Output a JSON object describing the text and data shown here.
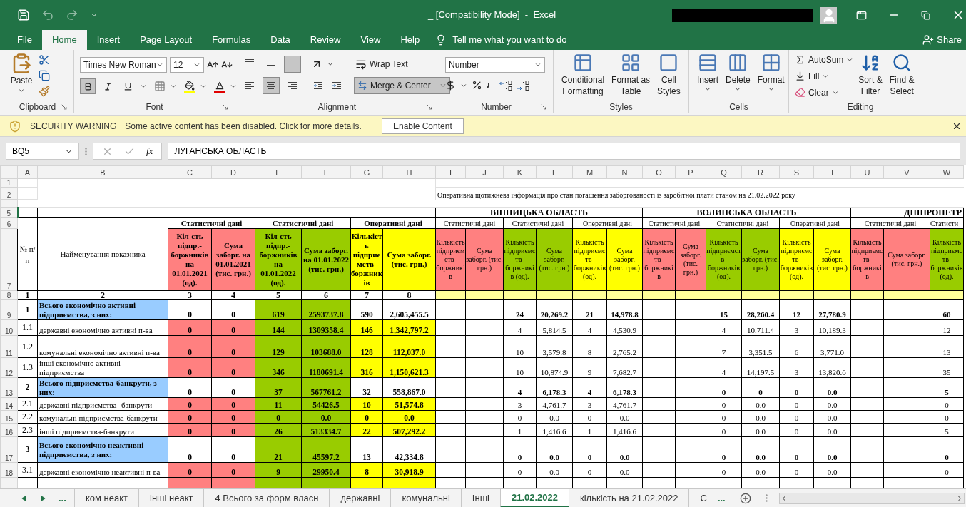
{
  "title_bar": {
    "title": "_ [Compatibility Mode]  -  Excel"
  },
  "ribbon_tabs": [
    {
      "label": "File",
      "selected": false
    },
    {
      "label": "Home",
      "selected": true
    },
    {
      "label": "Insert",
      "selected": false
    },
    {
      "label": "Page Layout",
      "selected": false
    },
    {
      "label": "Formulas",
      "selected": false
    },
    {
      "label": "Data",
      "selected": false
    },
    {
      "label": "Review",
      "selected": false
    },
    {
      "label": "View",
      "selected": false
    },
    {
      "label": "Help",
      "selected": false
    }
  ],
  "tell_me": "Tell me what you want to do",
  "share": "Share",
  "ribbon": {
    "clipboard": {
      "label": "Clipboard",
      "paste": "Paste"
    },
    "font": {
      "label": "Font",
      "family": "Times New Roman",
      "size": "12",
      "bold": true,
      "italic": false,
      "underline": false
    },
    "alignment": {
      "label": "Alignment",
      "vertical": [
        {
          "selected": false
        },
        {
          "selected": false
        },
        {
          "selected": true
        }
      ],
      "horizontal": [
        {
          "selected": false
        },
        {
          "selected": true
        },
        {
          "selected": false
        }
      ],
      "wrap_text": "Wrap Text",
      "merge": {
        "label": "Merge & Center",
        "selected": true
      }
    },
    "number": {
      "label": "Number",
      "format": "Number"
    },
    "styles": {
      "label": "Styles",
      "buttons": [
        [
          "Conditional",
          "Formatting"
        ],
        [
          "Format as",
          "Table"
        ],
        [
          "Cell",
          "Styles"
        ]
      ]
    },
    "cells": {
      "label": "Cells",
      "buttons": [
        "Insert",
        "Delete",
        "Format"
      ]
    },
    "editing": {
      "label": "Editing",
      "small": [
        "AutoSum",
        "Fill",
        "Clear"
      ],
      "big": [
        [
          "Sort &",
          "Filter"
        ],
        [
          "Find &",
          "Select"
        ]
      ]
    }
  },
  "security_bar": {
    "title": "SECURITY WARNING",
    "message": "Some active content has been disabled. Click for more details.",
    "button": "Enable Content"
  },
  "formula_bar": {
    "name_box": "BQ5",
    "function_label": "fx",
    "formula": "ЛУГАНСЬКА ОБЛАСТЬ"
  },
  "sheet": {
    "columns": [
      "A",
      "B",
      "C",
      "D",
      "E",
      "F",
      "G",
      "H",
      "I",
      "J",
      "K",
      "L",
      "M",
      "N",
      "O",
      "P",
      "Q",
      "R",
      "S",
      "T",
      "U",
      "V",
      "W"
    ],
    "title_rows": [
      {
        "number": "1"
      },
      {
        "number": "2",
        "text": "Оперативна щотижнева інформація про стан погашення заборгованості із заробітної плати станом на 21.02.2022 року"
      }
    ],
    "region_row": {
      "number": "5",
      "regions": [
        "ВІННИЦЬКА ОБЛАСТЬ",
        "ВОЛИНСЬКА ОБЛАСТЬ",
        "ДНІПРОПЕТР"
      ]
    },
    "group_row": {
      "number": "6",
      "groups": [
        "Статистичні дані",
        "Статистичні дані",
        "Оперативні дані",
        "Статистичні дані",
        "Статистичні дані",
        "Оперативні дані",
        "Статистичні дані",
        "Статистичні дані",
        "Оперативні дані",
        "Статистичні дані",
        "Статисти"
      ]
    },
    "header_row": {
      "number": "7",
      "index_header": "№ п/п",
      "name_header": "Найменування показника",
      "columns": [
        {
          "text": "Кіл-сть підпр.-боржників на 01.01.2021 (од).",
          "color": "#ff8080",
          "data_fill": true,
          "total_fill": false
        },
        {
          "text": "Сума заборг. на 01.01.2021 (тис. грн.)",
          "color": "#ff8080",
          "data_fill": true,
          "total_fill": false
        },
        {
          "text": "Кіл-сть підпр.-боржників на 01.01.2022 (од).",
          "color": "#99cc00",
          "data_fill": true,
          "total_fill": true
        },
        {
          "text": "Сума заборг. на 01.01.2022 (тис. грн.)",
          "color": "#99cc00",
          "data_fill": true,
          "total_fill": true
        },
        {
          "text": "Кількість підприємств-боржників",
          "color": "#ffff00",
          "data_fill": true,
          "total_fill": false
        },
        {
          "text": "Сума заборг. (тис. грн.)",
          "color": "#ffff00",
          "data_fill": true,
          "total_fill": false
        },
        {
          "text": "Кількість підприємств-боржників",
          "color": "#ff8080",
          "data_fill": false,
          "total_fill": false
        },
        {
          "text": "Сума заборг. (тис. грн.)",
          "color": "#ff8080",
          "data_fill": false,
          "total_fill": false
        },
        {
          "text": "Кількість підприємств-боржників (од).",
          "color": "#99cc00",
          "data_fill": false,
          "total_fill": false
        },
        {
          "text": "Сума заборг. (тис. грн.)",
          "color": "#99cc00",
          "data_fill": false,
          "total_fill": false
        },
        {
          "text": "Кількість підприємств-боржників (од).",
          "color": "#ffff00",
          "data_fill": false,
          "total_fill": false
        },
        {
          "text": "Сума заборг. (тис. грн.)",
          "color": "#ffff00",
          "data_fill": false,
          "total_fill": false
        },
        {
          "text": "Кількість підприємств-боржників",
          "color": "#ff8080",
          "data_fill": false,
          "total_fill": false
        },
        {
          "text": "Сума заборг. (тис. грн.)",
          "color": "#ff8080",
          "data_fill": false,
          "total_fill": false
        },
        {
          "text": "Кількість підприємств-боржників (од).",
          "color": "#99cc00",
          "data_fill": false,
          "total_fill": false
        },
        {
          "text": "Сума заборг. (тис. грн.)",
          "color": "#99cc00",
          "data_fill": false,
          "total_fill": false
        },
        {
          "text": "Кількість підприємств-боржників (од).",
          "color": "#ffff00",
          "data_fill": false,
          "total_fill": false
        },
        {
          "text": "Сума заборг. (тис. грн.)",
          "color": "#ffff00",
          "data_fill": false,
          "total_fill": false
        },
        {
          "text": "Кількість підприємств-боржників",
          "color": "#ff8080",
          "data_fill": false,
          "total_fill": false
        },
        {
          "text": "Сума заборг. (тис. грн.)",
          "color": "#ff8080",
          "data_fill": false,
          "total_fill": false
        },
        {
          "text": "Кількість підприємств-боржників (од).",
          "color": "#99cc00",
          "data_fill": false,
          "total_fill": false
        }
      ]
    },
    "index_row": {
      "number": "8",
      "cells": [
        "1",
        "2",
        "3",
        "4",
        "5",
        "6",
        "7",
        "8"
      ]
    },
    "rows": [
      {
        "number": "9",
        "kind": "total",
        "cells": [
          "1",
          "Всього економічно активні підприємства, з них:",
          "0",
          "0",
          "619",
          "2593737.8",
          "590",
          "2,605,455.5",
          null,
          null,
          "24",
          "20,269.2",
          "21",
          "14,978.8",
          null,
          null,
          "15",
          "28,260.4",
          "12",
          "27,780.9",
          null,
          null,
          "60"
        ]
      },
      {
        "number": "10",
        "kind": "item",
        "cells": [
          "1.1",
          "державні економічно активні п-ва",
          "0",
          "0",
          "144",
          "1309358.4",
          "146",
          "1,342,797.2",
          null,
          null,
          "4",
          "5,814.5",
          "4",
          "4,530.9",
          null,
          null,
          "4",
          "10,711.4",
          "3",
          "10,189.3",
          null,
          null,
          "12"
        ]
      },
      {
        "number": "11",
        "kind": "item",
        "cells": [
          "1.2",
          "комунальні економічно активні п-ва",
          "0",
          "0",
          "129",
          "103688.0",
          "128",
          "112,037.0",
          null,
          null,
          "10",
          "3,579.8",
          "8",
          "2,765.2",
          null,
          null,
          "7",
          "3,351.5",
          "6",
          "3,771.0",
          null,
          null,
          "13"
        ]
      },
      {
        "number": "12",
        "kind": "item",
        "cells": [
          "1.3",
          "інші економічно активні підприємства",
          "0",
          "0",
          "346",
          "1180691.4",
          "316",
          "1,150,621.3",
          null,
          null,
          "10",
          "10,874.9",
          "9",
          "7,682.7",
          null,
          null,
          "4",
          "14,197.5",
          "3",
          "13,820.6",
          null,
          null,
          "35"
        ]
      },
      {
        "number": "13",
        "kind": "total",
        "cells": [
          "2",
          "Всього підприємства-банкрути, з них:",
          "0",
          "0",
          "37",
          "567761.2",
          "32",
          "558,867.0",
          null,
          null,
          "4",
          "6,178.3",
          "4",
          "6,178.3",
          null,
          null,
          "0",
          "0",
          "0",
          "0.0",
          null,
          null,
          "5"
        ]
      },
      {
        "number": "14",
        "kind": "item",
        "cells": [
          "2.1",
          "державні підприємства- банкрути",
          "0",
          "0",
          "11",
          "54426.5",
          "10",
          "51,574.8",
          null,
          null,
          "3",
          "4,761.7",
          "3",
          "4,761.7",
          null,
          null,
          "0",
          "0.0",
          "0",
          "0.0",
          null,
          null,
          "0"
        ]
      },
      {
        "number": "15",
        "kind": "item",
        "cells": [
          "2.2",
          "комунальні підприємства-банкрути",
          "0",
          "0",
          "0",
          "0.0",
          "0",
          "0.0",
          null,
          null,
          "0",
          "0.0",
          "0",
          "0.0",
          null,
          null,
          "0",
          "0.0",
          "0",
          "0.0",
          null,
          null,
          "0"
        ]
      },
      {
        "number": "16",
        "kind": "item",
        "cells": [
          "2.3",
          "інші підприємства-банкрути",
          "0",
          "0",
          "26",
          "513334.7",
          "22",
          "507,292.2",
          null,
          null,
          "1",
          "1,416.6",
          "1",
          "1,416.6",
          null,
          null,
          "0",
          "0.0",
          "0",
          "0.0",
          null,
          null,
          "5"
        ]
      },
      {
        "number": "17",
        "kind": "total",
        "cells": [
          "3",
          "Всього економічно неактивні підприємства, з них:",
          "0",
          "0",
          "21",
          "45597.2",
          "13",
          "42,334.8",
          null,
          null,
          "0",
          "0.0",
          "0",
          "0.0",
          null,
          null,
          "0",
          "0.0",
          "0",
          "0.0",
          null,
          null,
          "0"
        ]
      },
      {
        "number": "18",
        "kind": "item",
        "cells": [
          "3.1",
          "державні економічно неактивні п-ва",
          "0",
          "0",
          "9",
          "29950.4",
          "8",
          "30,918.9",
          null,
          null,
          "0",
          "0.0",
          "0",
          "0.0",
          null,
          null,
          "0",
          "0.0",
          "0",
          "0.0",
          null,
          null,
          "0"
        ]
      }
    ]
  },
  "sheet_nav": {
    "overflow": "..."
  },
  "sheet_tabs": [
    {
      "label": "ком неакт",
      "selected": false
    },
    {
      "label": "інші неакт",
      "selected": false
    },
    {
      "label": "4 Всього за форм власн",
      "selected": false
    },
    {
      "label": "державні",
      "selected": false
    },
    {
      "label": "комунальні",
      "selected": false
    },
    {
      "label": "Інші",
      "selected": false
    },
    {
      "label": "21.02.2022",
      "selected": true
    },
    {
      "label": "кількість на 21.02.2022",
      "selected": false
    },
    {
      "label": "С",
      "selected": false
    }
  ],
  "sheet_tabs_overflow": "..."
}
